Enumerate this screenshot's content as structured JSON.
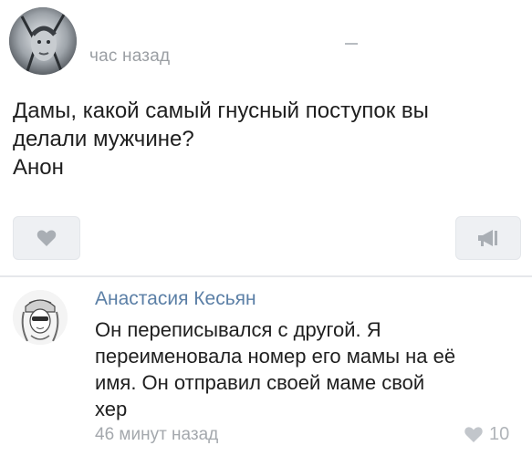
{
  "post": {
    "time": "час назад",
    "text_lines": [
      "Дамы, какой самый гнусный поступок вы",
      "делали мужчине?",
      "Анон"
    ],
    "like_icon": "heart-icon",
    "share_icon": "megaphone-icon"
  },
  "comment": {
    "author": "Анастасия Кесьян",
    "text_lines": [
      "Он переписывался с другой. Я",
      "переименовала номер его мамы на её",
      "имя. Он отправил своей маме свой",
      "хер"
    ],
    "time": "46 минут назад",
    "likes": "10",
    "like_icon": "heart-icon"
  },
  "colors": {
    "author": "#5b7fa6",
    "muted": "#9a9ea3",
    "button_bg": "#eef0f3",
    "icon": "#a9aeb4"
  }
}
